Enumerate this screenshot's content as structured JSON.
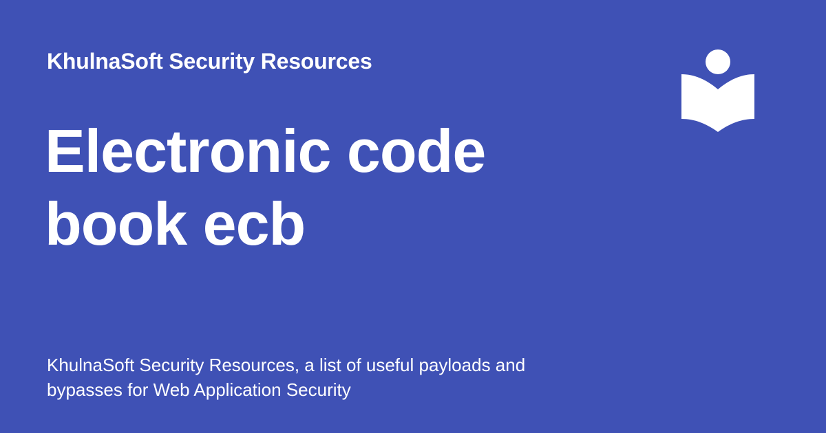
{
  "card": {
    "site_name": "KhulnaSoft Security Resources",
    "title": "Electronic code book ecb",
    "description": "KhulnaSoft Security Resources, a list of useful payloads and bypasses for Web Application Security"
  },
  "logo": {
    "icon": "reading-book-icon",
    "color": "#ffffff"
  },
  "colors": {
    "background": "#3f51b5",
    "text": "#ffffff"
  }
}
